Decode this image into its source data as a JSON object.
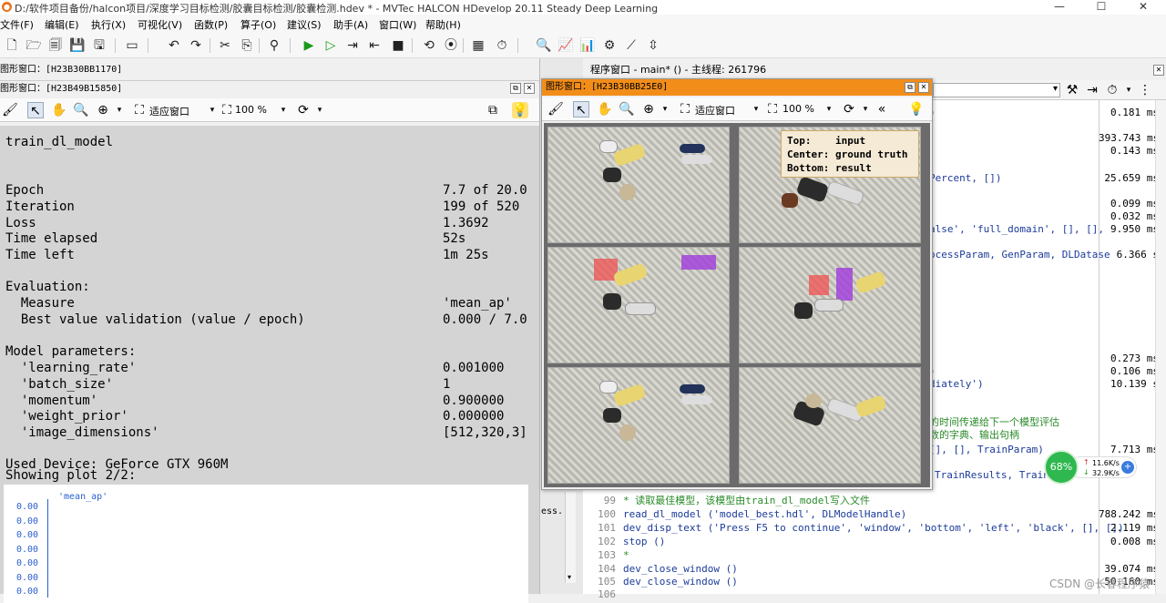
{
  "title_bar": {
    "title": "D:/软件项目备份/halcon项目/深度学习目标检测/胶囊目标检测/胶囊检测.hdev * - MVTec HALCON HDevelop 20.11 Steady Deep Learning",
    "minimize": "—",
    "maximize": "☐",
    "close": "✕"
  },
  "menu": {
    "items": [
      "文件(F)",
      "编辑(E)",
      "执行(X)",
      "可视化(V)",
      "函数(P)",
      "算子(O)",
      "建议(S)",
      "助手(A)",
      "窗口(W)",
      "帮助(H)"
    ]
  },
  "graphics_window_outer": {
    "title": "图形窗口：[H23B30BB1170]"
  },
  "graphics_window_left": {
    "title": "图形窗口：[H23B49B15850]",
    "fit_label": "适应窗口",
    "zoom": "100 %"
  },
  "training": {
    "title": "train_dl_model",
    "rows": [
      {
        "label": "Epoch",
        "value": "7.7 of 20.0"
      },
      {
        "label": "Iteration",
        "value": "199 of 520"
      },
      {
        "label": "Loss",
        "value": "1.3692"
      },
      {
        "label": "Time elapsed",
        "value": "52s"
      },
      {
        "label": "Time left",
        "value": "1m 25s"
      }
    ],
    "evaluation_header": "Evaluation:",
    "evaluation": [
      {
        "label": "  Measure",
        "value": "'mean_ap'"
      },
      {
        "label": "  Best value validation (value / epoch)",
        "value": "0.000 / 7.0"
      }
    ],
    "model_params_header": "Model parameters:",
    "model_params": [
      {
        "label": "  'learning_rate'",
        "value": "0.001000"
      },
      {
        "label": "  'batch_size'",
        "value": "1"
      },
      {
        "label": "  'momentum'",
        "value": "0.900000"
      },
      {
        "label": "  'weight_prior'",
        "value": "0.000000"
      },
      {
        "label": "  'image_dimensions'",
        "value": "[512,320,3]"
      }
    ],
    "device": "Used Device: GeForce GTX 960M",
    "plot_status": "Showing plot 2/2:"
  },
  "chart_data": {
    "type": "line",
    "series": [
      {
        "name": "'mean_ap'",
        "values": []
      }
    ],
    "y_ticks": [
      "0.00",
      "0.00",
      "0.00",
      "0.00",
      "0.00",
      "0.00",
      "0.00"
    ]
  },
  "program_window": {
    "title": "程序窗口 - main* () - 主线程: 261796"
  },
  "float_window": {
    "title": "图形窗口：[H23B30BB25E0]",
    "fit_label": "适应窗口",
    "zoom": "100 %",
    "legend": {
      "line1": "Top:    input",
      "line2": "Center: ground truth",
      "line3": "Bottom: result"
    }
  },
  "code": {
    "upper_lines": [
      {
        "text": ")",
        "time": "0.181 ms"
      },
      {
        "text": "",
        "time": "393.743 ms"
      },
      {
        "text": "",
        "time": "0.143 ms"
      },
      {
        "text": "Percent, [])",
        "time": "25.659 ms"
      },
      {
        "text": "",
        "time": "0.099 ms"
      },
      {
        "text": "",
        "time": "0.032 ms"
      },
      {
        "text": "alse', 'full_domain', [], [],",
        "time": "9.950 ms"
      },
      {
        "text": "ocessParam, GenParam, DLDatase",
        "time": "6.366 s"
      },
      {
        "text": "",
        "time": "0.273 ms"
      },
      {
        "text": ")",
        "time": "0.106 ms"
      },
      {
        "text": "diately')",
        "time": "10.139 s"
      },
      {
        "text": "的时间传递给下一个模型评估",
        "time": ""
      },
      {
        "text": "数的字典、输出句柄",
        "time": ""
      },
      {
        "text": "[], [], TrainParam)",
        "time": "7.713 ms"
      },
      {
        "text": "TrainResults, TrainI",
        "time": ""
      }
    ],
    "lines": [
      {
        "num": "99",
        "text": "* 读取最佳模型，该模型由train_dl_model写入文件",
        "time": ""
      },
      {
        "num": "100",
        "text": "read_dl_model ('model_best.hdl', DLModelHandle)",
        "time": "788.242 ms"
      },
      {
        "num": "101",
        "text": "dev_disp_text ('Press F5 to continue', 'window', 'bottom', 'left', 'black', [], [])",
        "time": "2.119 ms"
      },
      {
        "num": "102",
        "text": "stop ()",
        "time": "0.008 ms"
      },
      {
        "num": "103",
        "text": "*",
        "time": ""
      },
      {
        "num": "104",
        "text": "dev_close_window ()",
        "time": "39.074 ms"
      },
      {
        "num": "105",
        "text": "dev_close_window ()",
        "time": "50.160 ms"
      },
      {
        "num": "106",
        "text": "",
        "time": ""
      }
    ],
    "side_fragment": "ess..."
  },
  "network_widget": {
    "percent": "68%",
    "up": "11.6K/s",
    "down": "32.9K/s",
    "plus": "+"
  },
  "watermark": "CSDN @长春程序猿"
}
